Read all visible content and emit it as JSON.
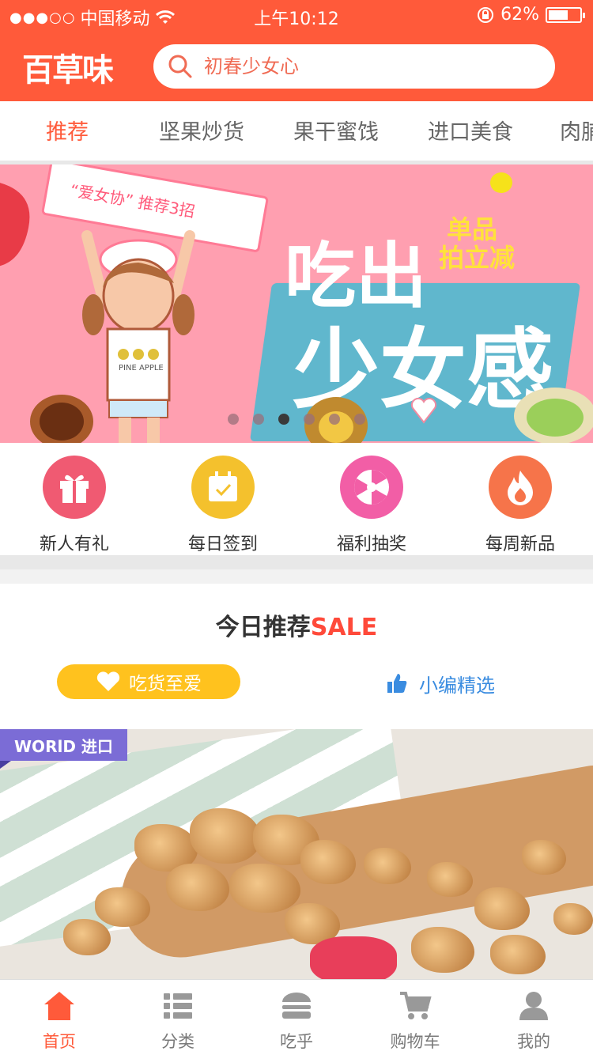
{
  "status_bar": {
    "signal": "●●●○○",
    "carrier": "中国移动",
    "time": "上午10:12",
    "battery_text": "62%",
    "battery_level": 0.62
  },
  "header": {
    "logo_text": "百草味",
    "search_placeholder": "初春少女心"
  },
  "tabs": [
    "推荐",
    "坚果炒货",
    "果干蜜饯",
    "进口美食",
    "肉脯"
  ],
  "banner": {
    "ribbon_text": "“爱女协” 推荐3招",
    "title_1": "吃出",
    "title_2": "少女感",
    "promo_1": "单品",
    "promo_2": "拍立减",
    "shirt_text": "PINE APPLE",
    "active_dot": 2,
    "dot_count": 6
  },
  "quick_entries": [
    {
      "label": "新人有礼",
      "color": "#f05a72",
      "icon": "gift-icon"
    },
    {
      "label": "每日签到",
      "color": "#f4c12d",
      "icon": "calendar-check-icon"
    },
    {
      "label": "福利抽奖",
      "color": "#f25ea6",
      "icon": "lottery-wheel-icon"
    },
    {
      "label": "每周新品",
      "color": "#f6744a",
      "icon": "flame-icon"
    }
  ],
  "recommend": {
    "title": "今日推荐",
    "sale": "SALE",
    "pill_label": "吃货至爱",
    "pick_label": "小编精选"
  },
  "product": {
    "badge": "WORlD 进口"
  },
  "tabbar": [
    {
      "label": "首页",
      "icon": "home-icon",
      "active": true
    },
    {
      "label": "分类",
      "icon": "category-list-icon",
      "active": false
    },
    {
      "label": "吃乎",
      "icon": "burger-icon",
      "active": false
    },
    {
      "label": "购物车",
      "icon": "cart-icon",
      "active": false
    },
    {
      "label": "我的",
      "icon": "user-icon",
      "active": false
    }
  ],
  "colors": {
    "brand": "#ff5a3a",
    "sale": "#ff4a3a",
    "pill": "#ffc21e",
    "pick": "#3a8ce0",
    "badge": "#7b6cd6"
  }
}
